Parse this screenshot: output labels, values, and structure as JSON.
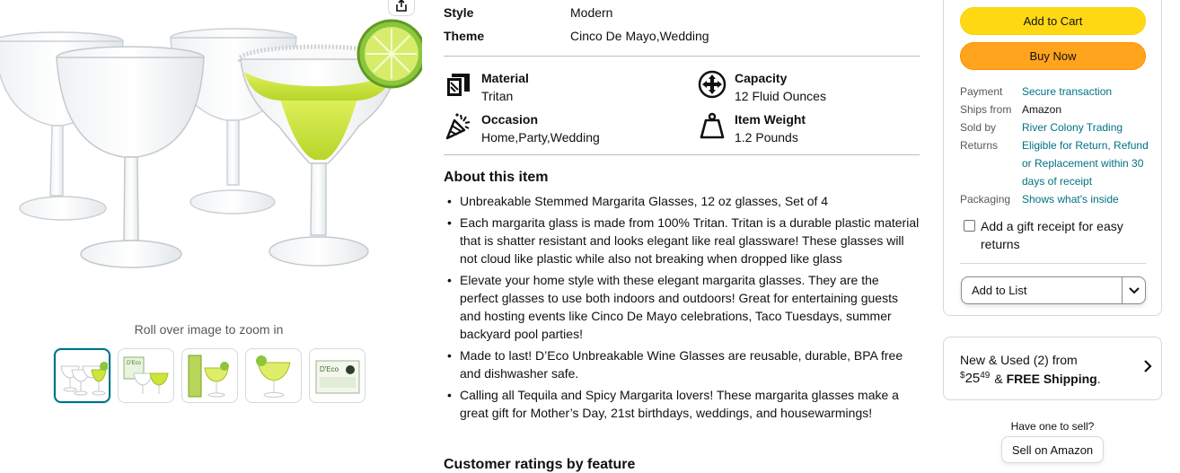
{
  "gallery": {
    "zoom_hint": "Roll over image to zoom in",
    "thumbnail_count": 5,
    "selected_thumbnail": 1,
    "thumb_labels": {
      "thumb2_brand": "D'Eco",
      "thumb5_brand": "D'Eco"
    }
  },
  "specs": [
    {
      "label": "Style",
      "value": "Modern"
    },
    {
      "label": "Theme",
      "value": "Cinco De Mayo,Wedding"
    }
  ],
  "features": [
    {
      "title": "Material",
      "value": "Tritan",
      "icon": "material-icon"
    },
    {
      "title": "Capacity",
      "value": "12 Fluid Ounces",
      "icon": "capacity-icon"
    },
    {
      "title": "Occasion",
      "value": "Home,Party,Wedding",
      "icon": "occasion-icon"
    },
    {
      "title": "Item Weight",
      "value": "1.2 Pounds",
      "icon": "weight-icon"
    }
  ],
  "about": {
    "title": "About this item",
    "bullets": [
      "Unbreakable Stemmed Margarita Glasses, 12 oz glasses, Set of 4",
      "Each margarita glass is made from 100% Tritan. Tritan is a durable plastic material that is shatter resistant and looks elegant like real glassware! These glasses will not cloud like plastic while also not breaking when dropped like glass",
      "Elevate your home style with these elegant margarita glasses. They are the perfect glasses to use both indoors and outdoors! Great for entertaining guests and hosting events like Cinco De Mayo celebrations, Taco Tuesdays, summer backyard pool parties!",
      "Made to last! D’Eco Unbreakable Wine Glasses are reusable, durable, BPA free and dishwasher safe.",
      "Calling all Tequila and Spicy Margarita lovers! These margarita glasses make a great gift for Mother’s Day, 21st birthdays, weddings, and housewarmings!"
    ]
  },
  "ratings": {
    "title": "Customer ratings by feature"
  },
  "buybox": {
    "add_to_cart": "Add to Cart",
    "buy_now": "Buy Now",
    "info": [
      {
        "key": "Payment",
        "value": "Secure transaction",
        "link": true
      },
      {
        "key": "Ships from",
        "value": "Amazon",
        "link": false
      },
      {
        "key": "Sold by",
        "value": "River Colony Trading",
        "link": true
      },
      {
        "key": "Returns",
        "value": "Eligible for Return, Refund or Replacement within 30 days of receipt",
        "link": true
      },
      {
        "key": "Packaging",
        "value": "Shows what's inside",
        "link": true
      }
    ],
    "gift_receipt": "Add a gift receipt for easy returns",
    "gift_checked": false,
    "add_to_list": "Add to List"
  },
  "used": {
    "title": "New & Used (2) from",
    "price_symbol": "$",
    "price_whole": "25",
    "price_fraction": "49",
    "shipping_prefix": "&",
    "shipping": "FREE Shipping",
    "shipping_suffix": "."
  },
  "sell": {
    "question": "Have one to sell?",
    "button": "Sell on Amazon"
  },
  "colors": {
    "cart_yellow": "#ffd814",
    "buy_orange": "#ffa41c",
    "link_teal": "#007185",
    "margarita_green": "#c9e23a"
  }
}
